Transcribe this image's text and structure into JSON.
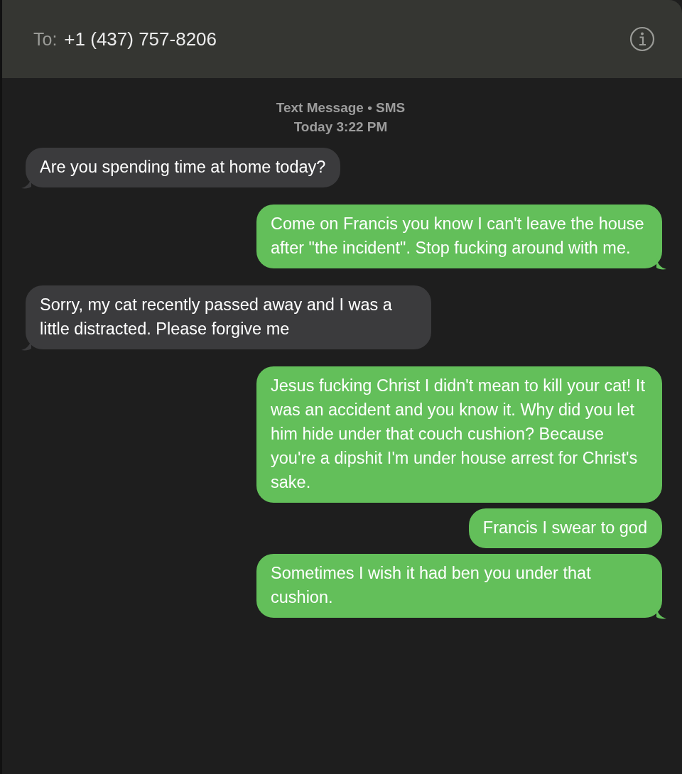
{
  "header": {
    "to_label": "To:",
    "recipient": "+1 (437) 757-8206"
  },
  "conversation_info": {
    "service": "Text Message • SMS",
    "timestamp": "Today 3:22 PM"
  },
  "messages": [
    {
      "kind": "incoming",
      "text": "Are you spending time at home today?",
      "tail": true
    },
    {
      "kind": "outgoing",
      "text": "Come on Francis you know I can't leave the house after \"the incident\". Stop fucking around with me.",
      "tail": true
    },
    {
      "kind": "incoming",
      "text": "Sorry, my cat  recently passed away and I was a little distracted. Please forgive me",
      "tail": true
    },
    {
      "kind": "outgoing",
      "text": "Jesus fucking Christ I didn't mean to kill your cat! It was an accident and you know it. Why did you let him hide under that couch cushion? Because you're a dipshit I'm under house arrest for Christ's sake.",
      "tail": false
    },
    {
      "kind": "outgoing",
      "text": "Francis I swear to god",
      "tail": false
    },
    {
      "kind": "outgoing",
      "text": "Sometimes I wish it had ben you under that cushion.",
      "tail": true
    }
  ]
}
